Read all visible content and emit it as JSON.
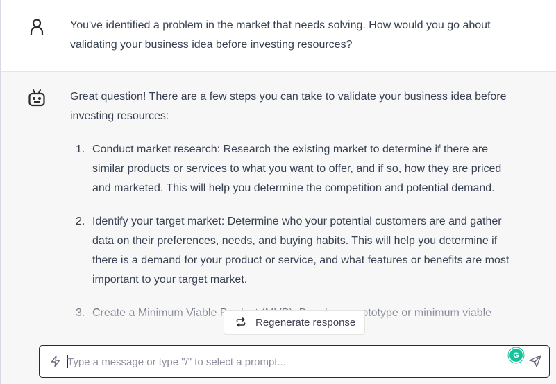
{
  "conversation": {
    "user_message": "You've identified a problem in the market that needs solving. How would you go about validating your business idea before investing resources?",
    "assistant_intro": "Great question! There are a few steps you can take to validate your business idea before investing resources:",
    "steps": [
      {
        "number": "1.",
        "text": "Conduct market research: Research the existing market to determine if there are similar products or services to what you want to offer, and if so, how they are priced and marketed. This will help you determine the competition and potential demand."
      },
      {
        "number": "2.",
        "text": "Identify your target market: Determine who your potential customers are and gather data on their preferences, needs, and buying habits. This will help you determine if there is a demand for your product or service, and what features or benefits are most important to your target market."
      },
      {
        "number": "3.",
        "text": "Create a Minimum Viable Product (MVP): Develop a prototype or minimum viable"
      }
    ]
  },
  "regenerate": {
    "label": "Regenerate response",
    "icon": "refresh-icon"
  },
  "composer": {
    "placeholder": "Type a message or type \"/\" to select a prompt...",
    "value": "",
    "grammarly_letter": "G",
    "icons": [
      "bolt-icon",
      "grammarly-icon",
      "send-icon"
    ]
  },
  "colors": {
    "assistant_bg": "#f7f7f8",
    "text": "#374151",
    "grammarly": "#15c39a"
  }
}
